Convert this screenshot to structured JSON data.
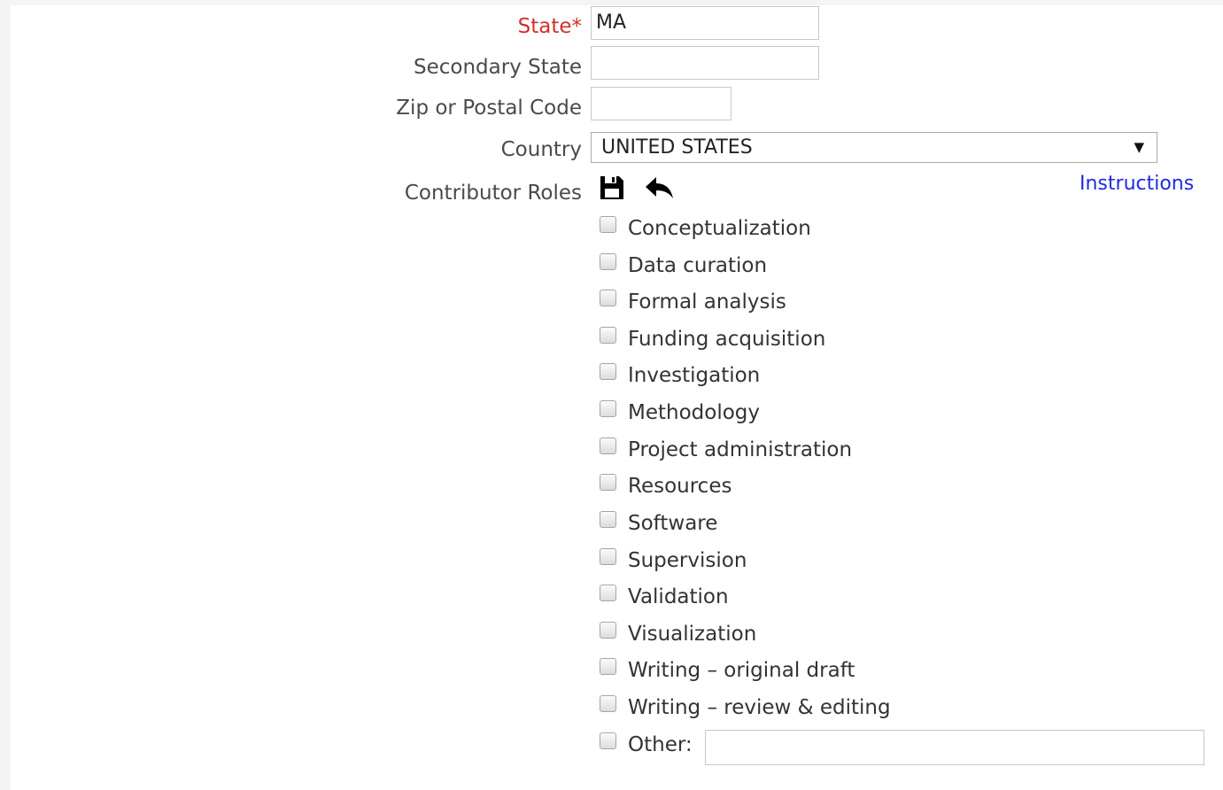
{
  "form": {
    "state": {
      "label": "State*",
      "value": "MA"
    },
    "secondary_state": {
      "label": "Secondary State",
      "value": ""
    },
    "zip": {
      "label": "Zip or Postal Code",
      "value": ""
    },
    "country": {
      "label": "Country",
      "value": "UNITED STATES",
      "arrow": "▼"
    },
    "contributor_roles": {
      "label": "Contributor Roles",
      "save_icon": "save-icon",
      "undo_icon": "reply-arrow-icon",
      "instructions_label": "Instructions",
      "roles": [
        "Conceptualization",
        "Data curation",
        "Formal analysis",
        "Funding acquisition",
        "Investigation",
        "Methodology",
        "Project administration",
        "Resources",
        "Software",
        "Supervision",
        "Validation",
        "Visualization",
        "Writing – original draft",
        "Writing – review & editing"
      ],
      "other_label": "Other:",
      "other_value": ""
    }
  },
  "colors": {
    "required_label": "#d0302a",
    "label": "#4a4a4a",
    "link": "#1d2be0"
  }
}
